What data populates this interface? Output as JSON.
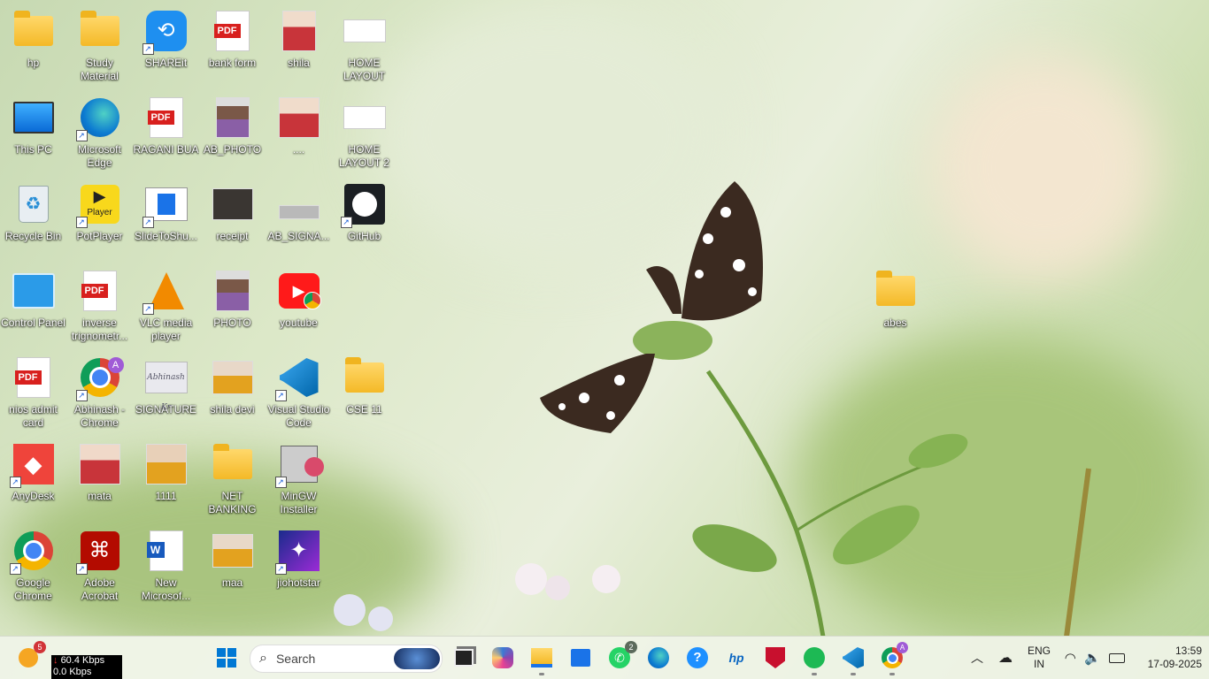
{
  "desktop": {
    "icons": [
      {
        "label": "hp"
      },
      {
        "label": "Study Material"
      },
      {
        "label": "SHAREit"
      },
      {
        "label": "bank form"
      },
      {
        "label": "shila"
      },
      {
        "label": "HOME LAYOUT"
      },
      {
        "label": "This PC"
      },
      {
        "label": "Microsoft Edge"
      },
      {
        "label": "RAGANI BUA"
      },
      {
        "label": "AB_PHOTO"
      },
      {
        "label": "...."
      },
      {
        "label": "HOME LAYOUT 2"
      },
      {
        "label": "Recycle Bin"
      },
      {
        "label": "PotPlayer"
      },
      {
        "label": "SlideToShu..."
      },
      {
        "label": "receipt"
      },
      {
        "label": "AB_SIGNA..."
      },
      {
        "label": "GitHub"
      },
      {
        "label": "Control Panel"
      },
      {
        "label": "inverse trignometr..."
      },
      {
        "label": "VLC media player"
      },
      {
        "label": "PHOTO"
      },
      {
        "label": "youtube"
      },
      {
        "label": "nios admit card"
      },
      {
        "label": "Abhinash - Chrome"
      },
      {
        "label": "SIGNATURE"
      },
      {
        "label": "shila devi"
      },
      {
        "label": "Visual Studio Code"
      },
      {
        "label": "CSE 11"
      },
      {
        "label": "AnyDesk"
      },
      {
        "label": "mata"
      },
      {
        "label": "1111"
      },
      {
        "label": "NET BANKING"
      },
      {
        "label": "MinGW Installer"
      },
      {
        "label": "Google Chrome"
      },
      {
        "label": "Adobe Acrobat"
      },
      {
        "label": "New Microsof..."
      },
      {
        "label": "maa"
      },
      {
        "label": "jiohotstar"
      },
      {
        "label": "abes"
      }
    ],
    "pdf_text": "PDF",
    "potplayer_text": "Player",
    "signature_text": "Abhinash Kr"
  },
  "taskbar": {
    "widget_badge": "5",
    "net_down": "60.4 Kbps",
    "net_up": "0.0 Kbps",
    "search_placeholder": "Search",
    "whatsapp_badge": "2",
    "chrome_profile": "A",
    "lang_line1": "ENG",
    "lang_line2": "IN",
    "time": "13:59",
    "date": "17-09-2025"
  },
  "colors": {
    "windows_blue": "#0078d4",
    "pdf_red": "#d8201e",
    "anydesk_red": "#ef443b"
  }
}
